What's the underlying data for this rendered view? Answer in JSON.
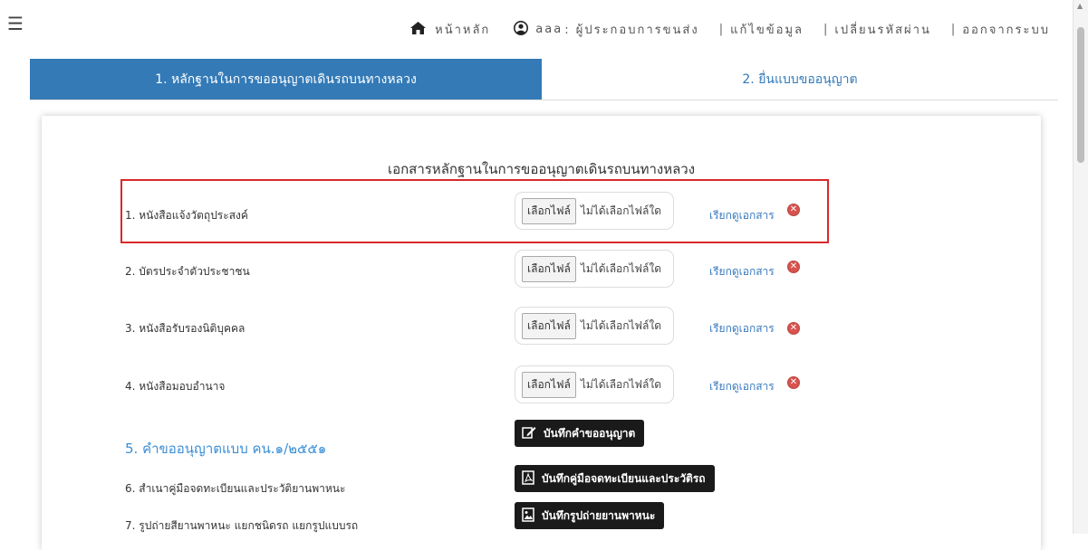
{
  "nav": {
    "menu_icon": "hamburger-icon",
    "home_label": "หน้าหลัก",
    "user_name": "aaa",
    "user_role": ": ผู้ประกอบการขนส่ง",
    "edit_label": "แก้ไขข้อมูล",
    "password_label": "เปลี่ยนรหัสผ่าน",
    "logout_label": "ออกจากระบบ",
    "separator": "|"
  },
  "tabs": [
    {
      "label": "1. หลักฐานในการขออนุญาตเดินรถบนทางหลวง",
      "active": true
    },
    {
      "label": "2. ยื่นแบบขออนุญาต",
      "active": false
    }
  ],
  "main": {
    "section_title": "เอกสารหลักฐานในการขออนุญาตเดินรถบนทางหลวง",
    "documents": [
      {
        "label": "1. หนังสือแจ้งวัตถุประสงค์",
        "file_button": "เลือกไฟล์",
        "file_status": "ไม่ได้เลือกไฟล์ใด",
        "view_label": "เรียกดูเอกสาร",
        "highlighted": true
      },
      {
        "label": "2. บัตรประจำตัวประชาชน",
        "file_button": "เลือกไฟล์",
        "file_status": "ไม่ได้เลือกไฟล์ใด",
        "view_label": "เรียกดูเอกสาร"
      },
      {
        "label": "3. หนังสือรับรองนิติบุคคล",
        "file_button": "เลือกไฟล์",
        "file_status": "ไม่ได้เลือกไฟล์ใด",
        "view_label": "เรียกดูเอกสาร"
      },
      {
        "label": "4. หนังสือมอบอำนาจ",
        "file_button": "เลือกไฟล์",
        "file_status": "ไม่ได้เลือกไฟล์ใด",
        "view_label": "เรียกดูเอกสาร"
      }
    ],
    "delete_icon_glyph": "✕",
    "form_heading": "5. คำขออนุญาตแบบ คน.๑/๒๕๕๑",
    "actions": [
      {
        "label": "บันทึกคำขออนุญาต",
        "icon": "edit-icon"
      },
      {
        "label": "บันทึกคู่มือจดทะเบียนและประวัติรถ",
        "icon": "pdf-icon"
      },
      {
        "label": "บันทึกรูปถ่ายยานพาหนะ",
        "icon": "image-icon"
      }
    ],
    "extra_items": [
      "6. สำเนาคู่มือจดทะเบียนและประวัติยานพาหนะ",
      "7. รูปถ่ายสียานพาหนะ แยกชนิดรถ แยกรูปแบบรถ"
    ]
  },
  "colors": {
    "tab_active": "#337ab7",
    "link": "#3a7bbf",
    "highlight_border": "#d9292a",
    "delete": "#d9534f",
    "heading": "#3a8fd6",
    "action_button": "#1a1a1a"
  }
}
